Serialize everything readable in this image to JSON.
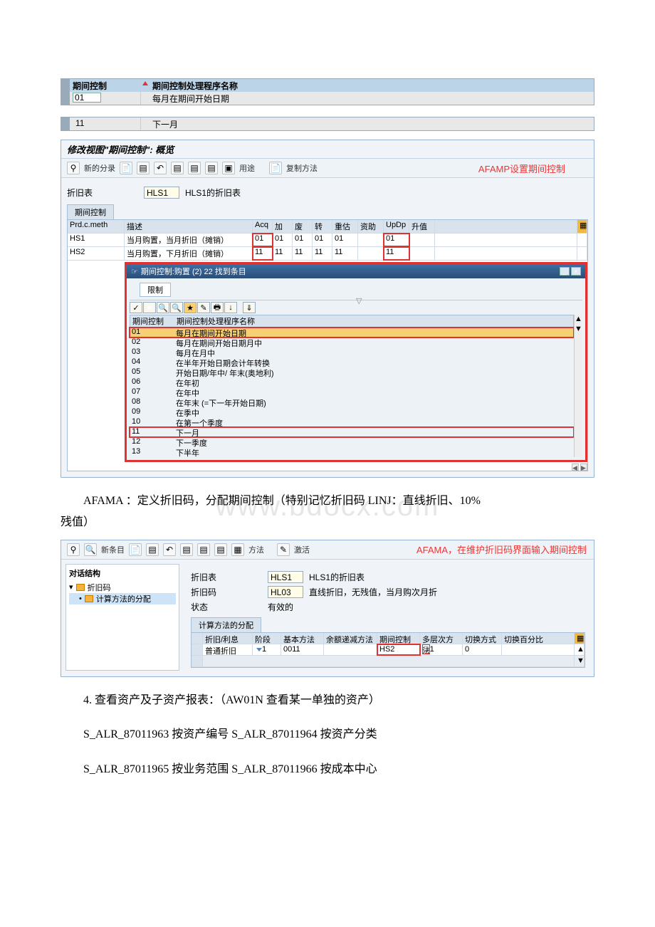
{
  "top_table": {
    "header_col1": "期间控制",
    "header_col2": "期间控制处理程序名称",
    "row_code": "01",
    "row_desc": "每月在期间开始日期"
  },
  "second_table": {
    "row_code": "11",
    "row_desc": "下一月"
  },
  "sap1": {
    "title": "修改视图\"期间控制\": 概览",
    "toolbar": {
      "new_entry": "新的分录",
      "usage": "用途",
      "copy_method": "复制方法"
    },
    "annotation": "AFAMP设置期间控制",
    "dep_table_label": "折旧表",
    "dep_table_code": "HLS1",
    "dep_table_desc": "HLS1的折旧表",
    "tab": "期间控制",
    "grid_headers": [
      "Prd.c.meth",
      "描述",
      "Acq",
      "加",
      "废",
      "转",
      "重估",
      "资助",
      "UpDp",
      "升值"
    ],
    "grid_rows": [
      {
        "method": "HS1",
        "desc": "当月购置，当月折旧（摊销）",
        "vals": [
          "01",
          "01",
          "01",
          "01",
          "01",
          "",
          "01",
          ""
        ],
        "red": true
      },
      {
        "method": "HS2",
        "desc": "当月购置，下月折旧（摊销）",
        "vals": [
          "11",
          "11",
          "11",
          "11",
          "11",
          "",
          "11",
          ""
        ],
        "red": true
      }
    ],
    "popup": {
      "title": "期间控制:购置 (2)   22 找到条目",
      "restrict": "限制",
      "list_head1": "期间控制",
      "list_head2": "期间控制处理程序名称",
      "items": [
        {
          "code": "01",
          "desc": "每月在期间开始日期",
          "sel": true
        },
        {
          "code": "02",
          "desc": "每月在期间开始日期月中"
        },
        {
          "code": "03",
          "desc": "每月在月中"
        },
        {
          "code": "04",
          "desc": "在半年开始日期会计年转换"
        },
        {
          "code": "05",
          "desc": "开始日期/年中/ 年末(奥地利)"
        },
        {
          "code": "06",
          "desc": "在年初"
        },
        {
          "code": "07",
          "desc": "在年中"
        },
        {
          "code": "08",
          "desc": "在年末 (=下一年开始日期)"
        },
        {
          "code": "09",
          "desc": "在季中"
        },
        {
          "code": "10",
          "desc": "在第一个季度"
        },
        {
          "code": "11",
          "desc": "下一月",
          "box": true
        },
        {
          "code": "12",
          "desc": "下一季度"
        },
        {
          "code": "13",
          "desc": "下半年"
        }
      ]
    }
  },
  "body_text1a": "AFAMA ：定义折旧码，分配期间控制（特别记忆折旧码 LINJ：直线折旧、10%",
  "body_text1b": "残值）",
  "watermark": "www.bdocx.com",
  "sap2": {
    "toolbar": {
      "new_entry": "新条目",
      "method": "方法",
      "activate": "激活"
    },
    "annotation": "AFAMA，在维护折旧码界面输入期间控制",
    "tree": {
      "title": "对话结构",
      "item1": "折旧码",
      "item2": "计算方法的分配"
    },
    "form": {
      "dep_table_lbl": "折旧表",
      "dep_table_code": "HLS1",
      "dep_table_desc": "HLS1的折旧表",
      "dep_code_lbl": "折旧码",
      "dep_code_code": "HL03",
      "dep_code_desc": "直线折旧，无残值，当月购次月折",
      "status_lbl": "状态",
      "status_val": "有效的"
    },
    "tab": "计算方法的分配",
    "grid_headers": [
      "折旧/利息",
      "阶段",
      "基本方法",
      "余额递减方法",
      "期间控制",
      "多层次方法",
      "切换方式",
      "切换百分比"
    ],
    "row": {
      "type": "普通折旧",
      "stage": "1",
      "base": "0011",
      "decl": "",
      "period": "HS2",
      "multi": "1",
      "switch": "0",
      "pct": ""
    }
  },
  "body_text2": "4.   查看资产及子资产报表：（AW01N 查看某一单独的资产）",
  "body_text3": "S_ALR_87011963 按资产编号 S_ALR_87011964 按资产分类",
  "body_text4": "S_ALR_87011965 按业务范围 S_ALR_87011966 按成本中心"
}
